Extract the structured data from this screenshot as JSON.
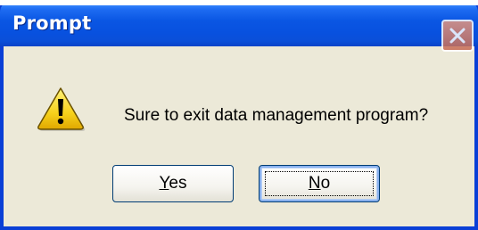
{
  "dialog": {
    "title": "Prompt",
    "message": "Sure to exit data management program?",
    "icon": "warning-icon",
    "buttons": {
      "yes_mnemonic": "Y",
      "yes_rest": "es",
      "no_mnemonic": "N",
      "no_rest": "o"
    }
  },
  "colors": {
    "titlebar": "#0a56e3",
    "frame": "#0a3fd6",
    "body": "#ece9d8",
    "close_button": "#d98a74",
    "warning": "#f7d21c"
  }
}
